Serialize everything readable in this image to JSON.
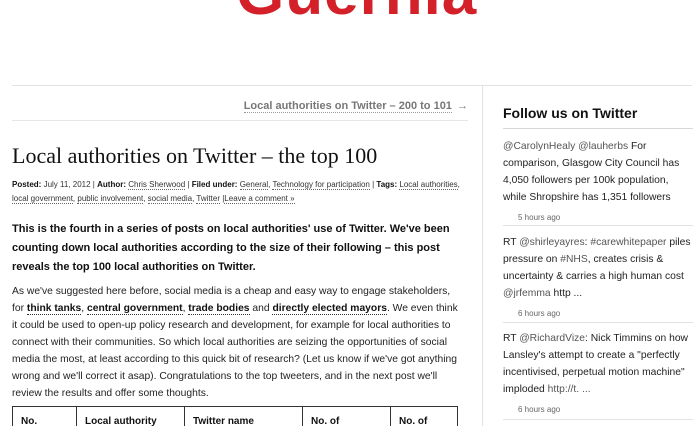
{
  "site": {
    "logo_text": "Guernia",
    "brand_color": "#d42028"
  },
  "post_nav": {
    "next_label": "Local authorities on Twitter – 200 to 101",
    "arrow": "→"
  },
  "post": {
    "title": "Local authorities on Twitter – the top 100",
    "meta": {
      "posted_label": "Posted:",
      "date": "July 11, 2012",
      "author_label": "Author:",
      "author": "Chris Sherwood",
      "filed_label": "Filed under:",
      "categories": [
        "General",
        "Technology for participation"
      ],
      "tags_label": "Tags:",
      "tags": [
        "Local authorities",
        "local government",
        "public involvement",
        "social media",
        "Twitter"
      ],
      "comment_link": "Leave a comment »"
    },
    "lead": "This is the fourth in a series of posts on local authorities' use of Twitter. We've been counting down local authorities according to the size of their following – this post reveals the top 100 local authorities on Twitter.",
    "body": {
      "p1": "As we've suggested here before, social media is a cheap and easy way to engage stakeholders, for",
      "link_think_tanks": "think tanks",
      "link_central_gov": "central government",
      "link_trade_bodies": "trade bodies",
      "and_word": "and",
      "link_mayors": "directly elected mayors",
      "p2": ". We even think it could be used to open-up policy research and development, for example for local authorities to connect with their communities. So which local authorities are seizing the opportunities of social media the most, at least according to this quick bit of research? (Let us know if we've got anything wrong and we'll correct it asap). Congratulations to the top tweeters, and in the next post we'll review the results and offer some thoughts."
    },
    "table_headers": [
      "No.",
      "Local authority",
      "Twitter name",
      "No. of",
      "No. of"
    ]
  },
  "sidebar": {
    "title": "Follow us on Twitter",
    "tweets": [
      {
        "handle1": "@CarolynHealy",
        "handle2": "@lauherbs",
        "text": " For comparison, Glasgow City Council has 4,050 followers per 100k population, while Shropshire has 1,351 followers",
        "time": "5 hours ago"
      },
      {
        "prefix": "RT ",
        "handle1": "@shirleyayres",
        "mid": ": ",
        "hashtag1": "#carewhitepaper",
        "text1": " piles pressure on ",
        "hashtag2": "#NHS",
        "text2": ", creates crisis & uncertainty & carries a high human cost ",
        "handle2": "@jrfemma",
        "text3": " http ...",
        "time": "6 hours ago"
      },
      {
        "prefix": "RT ",
        "handle1": "@RichardVize",
        "text": ": Nick Timmins on how Lansley's attempt to create a \"perfectly incentivised, perpetual motion machine\" imploded ",
        "link": "http://t. ...",
        "time": "6 hours ago"
      }
    ]
  }
}
